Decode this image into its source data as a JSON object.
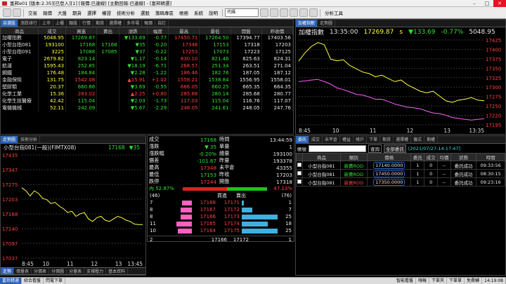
{
  "window": {
    "title": "富邦e01 [版本:2.35][已登入][1] [報價:已連線] [主動回報:已連線] - [富邦精選]",
    "min": "–",
    "max": "□",
    "close": "✕"
  },
  "menu": {
    "items": [
      "交易",
      "報價",
      "大盤",
      "期貨",
      "選擇",
      "權證",
      "技術分析",
      "選股",
      "籌碼專區",
      "帳務",
      "系統",
      "說明"
    ],
    "combo": "代碼",
    "right": "分析工具"
  },
  "quote": {
    "tabs": [
      "自選股",
      "漲跌排行",
      "上市",
      "上櫃",
      "類股",
      "行情",
      "期貨",
      "選擇權",
      "多市場",
      "報價",
      "自訂"
    ],
    "headers": [
      "商品",
      "成交",
      "買進",
      "賣出",
      "漲跌",
      "幅度",
      "最高",
      "最低",
      "開盤",
      "昨收價"
    ],
    "rows": [
      {
        "name": "加權指數",
        "price": "5048.95",
        "bid": "17269.87",
        "ask": "",
        "chg": "▼133.69",
        "pct": "-0.77",
        "high": "17450.71",
        "low": "17264.50",
        "open": "17394.77",
        "prev": "17403.56"
      },
      {
        "name": "小型台指081",
        "price": "193100",
        "bid": "17168",
        "ask": "17168",
        "ask2": "17171",
        "chg": "▼35",
        "pct": "-0.20",
        "high": "17348",
        "low": "17153",
        "open": "17318",
        "prev": "17203"
      },
      {
        "name": "小型台指091",
        "price": "3225",
        "bid": "17088",
        "ask": "17085",
        "ask2": "17091",
        "chg": "▼37",
        "pct": "-0.22",
        "high": "17253",
        "low": "17073",
        "open": "17223",
        "prev": "17125"
      },
      {
        "name": "電子",
        "price": "2679.82",
        "bid": "823.14",
        "ask": "",
        "chg": "▼1.17",
        "pct": "-0.14",
        "high": "830.10",
        "low": "821.46",
        "open": "825.63",
        "prev": "824.31"
      },
      {
        "name": "航運",
        "price": "1595.43",
        "bid": "252.85",
        "ask": "",
        "chg": "▼18.19",
        "pct": "-6.71",
        "high": "268.57",
        "low": "251.34",
        "open": "263.51",
        "prev": "271.04"
      },
      {
        "name": "鋼鐵",
        "price": "176.48",
        "bid": "184.84",
        "ask": "",
        "chg": "▼2.28",
        "pct": "-1.22",
        "high": "186.46",
        "low": "182.76",
        "open": "187.05",
        "prev": "187.12"
      },
      {
        "name": "金融保險",
        "price": "131.75",
        "bid": "1542.08",
        "ask": "",
        "chg": "▲15.91",
        "pct": "+1.02",
        "high": "1558.21",
        "low": "1538.84",
        "open": "1556.95",
        "prev": "1558.01"
      },
      {
        "name": "塑膠類",
        "price": "20.37",
        "bid": "660.66",
        "ask": "",
        "chg": "▼3.69",
        "pct": "-0.55",
        "high": "666.05",
        "low": "660.25",
        "open": "665.35",
        "prev": "664.35"
      },
      {
        "name": "化學工業",
        "price": "15.36",
        "bid": "283.02",
        "ask": "",
        "chg": "▲2.25",
        "pct": "+0.80",
        "high": "285.68",
        "low": "280.14",
        "open": "285.68",
        "prev": "280.77"
      },
      {
        "name": "化學生技醫療",
        "price": "42.42",
        "bid": "115.04",
        "ask": "",
        "chg": "▼2.03",
        "pct": "-1.73",
        "high": "117.03",
        "low": "115.04",
        "open": "116.76",
        "prev": "117.07"
      },
      {
        "name": "電機機械",
        "price": "52.11",
        "bid": "242.09",
        "ask": "",
        "chg": "▼5.67",
        "pct": "-2.29",
        "high": "248.05",
        "low": "241.61",
        "open": "248.05",
        "prev": "247.76"
      }
    ],
    "footer": "移交換"
  },
  "index_chart": {
    "tabs": [
      "加權指數",
      "走勢圖"
    ],
    "name": "加權指數",
    "time": "13:35:00",
    "value": "17269.87",
    "unit": "s",
    "change": "▼133.69",
    "pct": "-0.77%",
    "volume": "5048.95",
    "ylabels": [
      "17425",
      "17400",
      "17375",
      "17350",
      "17325",
      "17300",
      "17275",
      "17250",
      "17220",
      "17195"
    ],
    "xlabels": [
      "8:45",
      "10",
      "11",
      "12",
      "13",
      "13:35"
    ]
  },
  "chart_data": [
    {
      "type": "line",
      "title": "加權指數",
      "series": [
        {
          "name": "",
          "values": [
            17394,
            17420,
            17440,
            17452,
            17445,
            17400,
            17395,
            17398,
            17380,
            17370,
            17360,
            17355,
            17345,
            17350,
            17340,
            17330,
            17335,
            17320,
            17310,
            17300,
            17295,
            17300,
            17285,
            17270,
            17265,
            17272,
            17275,
            17280,
            17272,
            17270
          ]
        },
        {
          "values": [
            17330,
            17332,
            17335,
            17337,
            17330,
            17322,
            17310,
            17305,
            17298,
            17290,
            17288,
            17282,
            17275,
            17275,
            17268,
            17260,
            17255,
            17250,
            17248,
            17245,
            17238,
            17232,
            17230,
            17225,
            17218,
            17215,
            17212,
            17210,
            17212,
            17214
          ]
        }
      ],
      "x": [
        "8:45",
        "",
        "",
        "",
        "",
        "",
        "10",
        "",
        "",
        "",
        "",
        "",
        "11",
        "",
        "",
        "",
        "",
        "",
        "12",
        "",
        "",
        "",
        "",
        "",
        "13",
        "",
        "",
        "",
        "",
        "13:35"
      ],
      "ylim": [
        17195,
        17460
      ]
    },
    {
      "type": "line",
      "title": "小型台指081(一般)(FIMTX08)",
      "series": [
        {
          "values": [
            17312,
            17300,
            17280,
            17300,
            17290,
            17270,
            17265,
            17250,
            17255,
            17240,
            17230,
            17215,
            17220,
            17200,
            17210,
            17215,
            17190,
            17180,
            17195,
            17200,
            17185,
            17180,
            17190,
            17200,
            17195,
            17185,
            17180,
            17170,
            17168,
            17168
          ]
        }
      ],
      "x": [
        "8:45",
        "",
        "",
        "",
        "",
        "",
        "10",
        "",
        "",
        "",
        "",
        "",
        "11",
        "",
        "",
        "",
        "",
        "",
        "12",
        "",
        "",
        "",
        "",
        "",
        "13",
        "",
        "",
        "",
        "",
        "13:45"
      ],
      "ylim": [
        17037,
        17440
      ]
    }
  ],
  "tick": {
    "tabs": [
      "走勢圖",
      "技術分析"
    ],
    "title": "小型台指081(一般)(FIMTX08)",
    "price": "17168",
    "chg": "▼35",
    "ylabels": [
      "17435",
      "17347",
      "17275",
      "17203",
      "17168",
      "17140",
      "17097",
      "17037"
    ],
    "xlabels": [
      "8:45",
      "10",
      "11",
      "12",
      "13",
      "13:45"
    ],
    "bottomtabs": [
      "走勢",
      "價量表",
      "分價表",
      "分價圖",
      "分量表",
      "支撐壓力",
      "基本資料"
    ]
  },
  "detail": {
    "rows": [
      [
        "成交",
        "17168",
        "時間",
        "13:44:59"
      ],
      [
        "漲跌",
        "▼ 35",
        "單量",
        "1"
      ],
      [
        "漲跌幅",
        "-0.20%",
        "總量",
        "193100"
      ],
      [
        "價差",
        "-101.87",
        "昨量",
        "193378"
      ],
      [
        "最高",
        "17348",
        "未平倉",
        "43355"
      ],
      [
        "最低",
        "17153",
        "昨收",
        "17203"
      ],
      [
        "跌停",
        "17244",
        "開盤",
        "17318"
      ]
    ],
    "inner_pct": "內 52.87%",
    "outer_pct": "47.13%",
    "buy_total": "(46)",
    "sell_total": "(76)",
    "hdr_buy": "買進",
    "hdr_sell": "賣出",
    "book": [
      {
        "bq": "7",
        "bp": "17168",
        "sp": "17171",
        "sq": "1",
        "bw": 0.35,
        "sw": 0.05
      },
      {
        "bq": "8",
        "bp": "17167",
        "sp": "17172",
        "sq": "7",
        "bw": 0.4,
        "sw": 0.3
      },
      {
        "bq": "8",
        "bp": "17166",
        "sp": "17173",
        "sq": "25",
        "bw": 0.4,
        "sw": 1.0
      },
      {
        "bq": "11",
        "bp": "17165",
        "sp": "17174",
        "sq": "18",
        "bw": 0.55,
        "sw": 0.72
      },
      {
        "bq": "10",
        "bp": "17164",
        "sp": "17175",
        "sq": "25",
        "bw": 0.5,
        "sw": 1.0
      }
    ],
    "last": {
      "bq": "2",
      "bp": "17166",
      "sp": "17172",
      "sq": "1"
    }
  },
  "orders": {
    "tabs": [
      "委託",
      "成交",
      "未平倉",
      "權益",
      "帳戶",
      "下單",
      "期貨",
      "選擇權",
      "複式",
      "期權"
    ],
    "account": "帳號",
    "query": "查詢",
    "filter": "全部委託",
    "time_label": "[2021/07/27-14:17:47]",
    "headers": [
      "",
      "商品",
      "類別",
      "價格",
      "委託",
      "成交",
      "均價",
      "狀態",
      "時間"
    ],
    "rows": [
      {
        "item": "小型台指081",
        "type": "新賣ROD",
        "price": "17140.0000",
        "qty": "1",
        "fill": "0",
        "avg": "--",
        "status": "委託成功",
        "time": "09:33:56"
      },
      {
        "item": "小型台指081",
        "type": "新賣ROD",
        "price": "17450.0000",
        "qty": "1",
        "fill": "0",
        "avg": "--",
        "status": "委託成功",
        "time": "08:30:15"
      },
      {
        "item": "小型台指081",
        "type": "新買ROD",
        "price": "17350.0000",
        "qty": "1",
        "fill": "0",
        "avg": "--",
        "status": "委託成功",
        "time": "09:23:16"
      }
    ]
  },
  "taskbar": {
    "items": [
      "富邦精選",
      "綜合看盤",
      "閃電下單"
    ],
    "right": [
      "智能看盤",
      "嗨報",
      "下單夾",
      "下單單",
      "免費轉",
      "14:19:08"
    ]
  }
}
